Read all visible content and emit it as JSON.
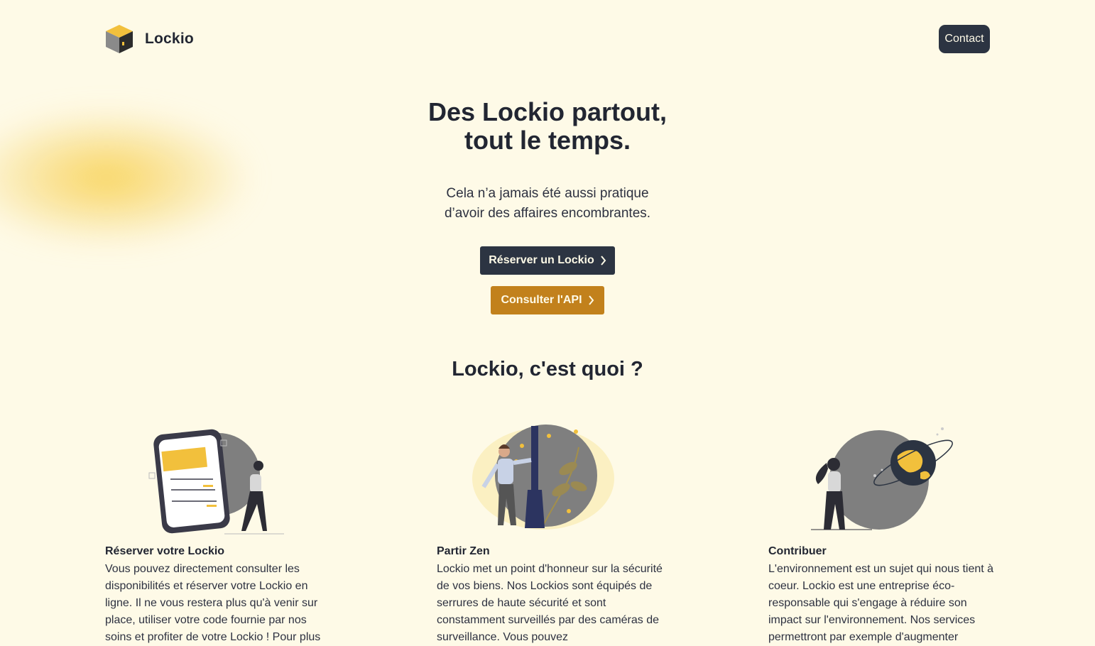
{
  "header": {
    "brand": "Lockio",
    "contact_label": "Contact"
  },
  "hero": {
    "title_line1": "Des Lockio partout,",
    "title_line2": "tout le temps.",
    "subtitle_line1": "Cela n’a jamais été aussi pratique",
    "subtitle_line2": "d’avoir des affaires encombrantes.",
    "reserve_label": "Réserver un Lockio",
    "api_label": "Consulter l'API"
  },
  "about": {
    "title": "Lockio, c'est quoi ?",
    "features": [
      {
        "title": "Réserver votre Lockio",
        "text": "Vous pouvez directement consulter les disponibilités et réserver votre Lockio en ligne. Il ne vous restera plus qu'à venir sur place, utiliser votre code fournie par nos soins et profiter de votre Lockio ! Pour plus",
        "illustration": "phone-booking-illustration"
      },
      {
        "title": "Partir Zen",
        "text": "Lockio met un point d'honneur sur la sécurité de vos biens. Nos Lockios sont équipés de serrures de haute sécurité et sont constamment surveillés par des caméras de surveillance. Vous pouvez",
        "illustration": "security-illustration"
      },
      {
        "title": "Contribuer",
        "text": "L'environnement est un sujet qui nous tient à coeur. Lockio est une entreprise éco-responsable qui s'engage à réduire son impact sur l'environnement. Nos services permettront par exemple d'augmenter",
        "illustration": "planet-illustration"
      }
    ]
  },
  "colors": {
    "background": "#fefae7",
    "dark": "#2c3442",
    "accent": "#c2811c",
    "yellow": "#f2c03c",
    "grey": "#7f7f7f"
  }
}
